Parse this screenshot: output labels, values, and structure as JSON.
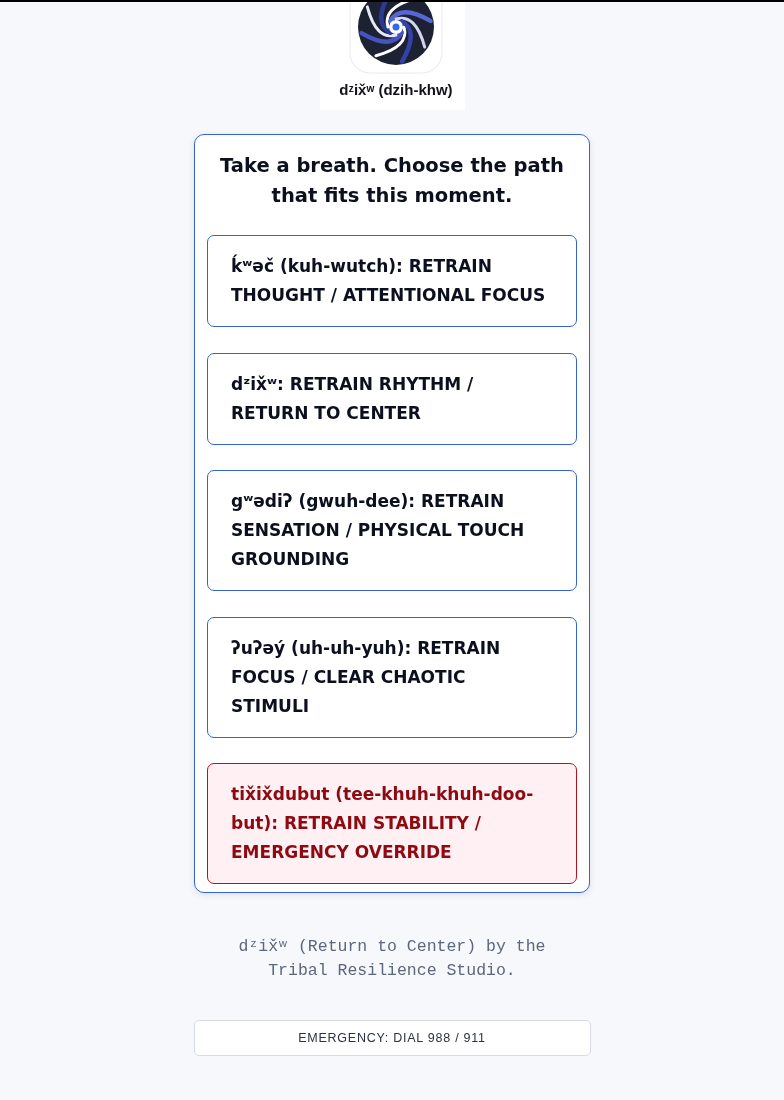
{
  "header": {
    "app_name": "dᶻix̌ʷ (dzih-khw)"
  },
  "card": {
    "title": "Take a breath. Choose the path that fits this moment.",
    "options": [
      {
        "kind": "standard",
        "label": "ḱʷəč (kuh-wutch): RETRAIN THOUGHT / ATTENTIONAL FOCUS"
      },
      {
        "kind": "standard",
        "label": "dᶻix̌ʷ: RETRAIN RHYTHM / RETURN TO CENTER"
      },
      {
        "kind": "standard",
        "label": "gʷədiʔ (gwuh-dee): RETRAIN SENSATION / PHYSICAL TOUCH GROUNDING"
      },
      {
        "kind": "standard",
        "label": "ʔuʔəý (uh-uh-yuh): RETRAIN FOCUS / CLEAR CHAOTIC STIMULI"
      },
      {
        "kind": "emergency",
        "label": "tix̌ix̌dubut (tee-khuh-khuh-doo-but): RETRAIN STABILITY / EMERGENCY OVERRIDE"
      }
    ]
  },
  "footer": {
    "credit": "dᶻix̌ʷ (Return to Center) by the Tribal Resilience Studio.",
    "emergency": "EMERGENCY: DIAL 988 / 911"
  }
}
